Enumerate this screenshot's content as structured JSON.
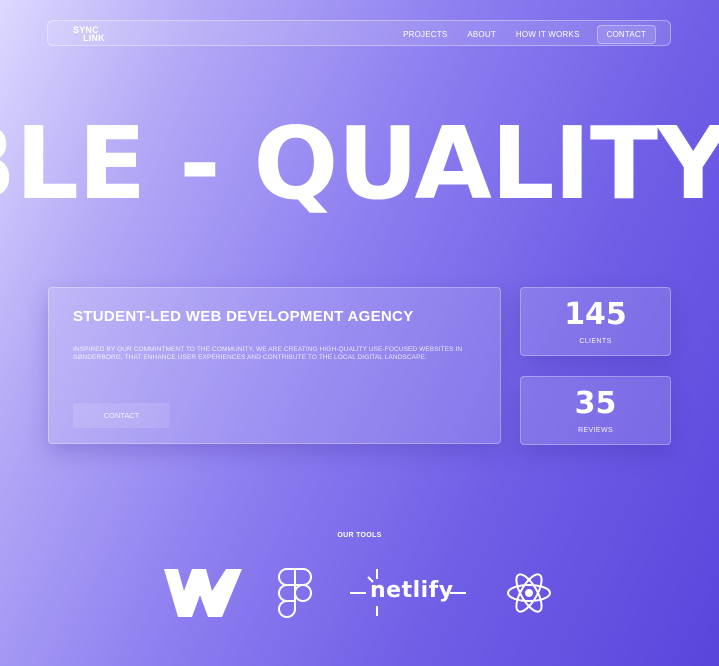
{
  "nav": {
    "logo_line1": "SYNC",
    "logo_line2": "LINK",
    "links": [
      "PROJECTS",
      "ABOUT",
      "HOW IT WORKS"
    ],
    "cta": "CONTACT"
  },
  "hero": {
    "marquee": "BLE - QUALITY - "
  },
  "card": {
    "title": "STUDENT-LED WEB DEVELOPMENT AGENCY",
    "description": "INSPIRED BY OUR COMMINTMENT TO THE COMMUNITY, WE ARE CREATING HIGH-QUALITY USE-FOCUSED WEBSITES IN SØNDERBORG, THAT ENHANCE USER EXPERIENCES AND CONTRIBUTE TO THE LOCAL DIGITAL LANDSCAPE.",
    "button": "CONTACT"
  },
  "stats": [
    {
      "value": "145",
      "label": "CLIENTS"
    },
    {
      "value": "35",
      "label": "REVIEWS"
    }
  ],
  "tools": {
    "title": "OUR TOOLS",
    "items": [
      {
        "icon": "webflow-logo"
      },
      {
        "icon": "figma-logo"
      },
      {
        "icon": "netlify-logo",
        "text": "netlify"
      },
      {
        "icon": "react-logo"
      }
    ]
  }
}
